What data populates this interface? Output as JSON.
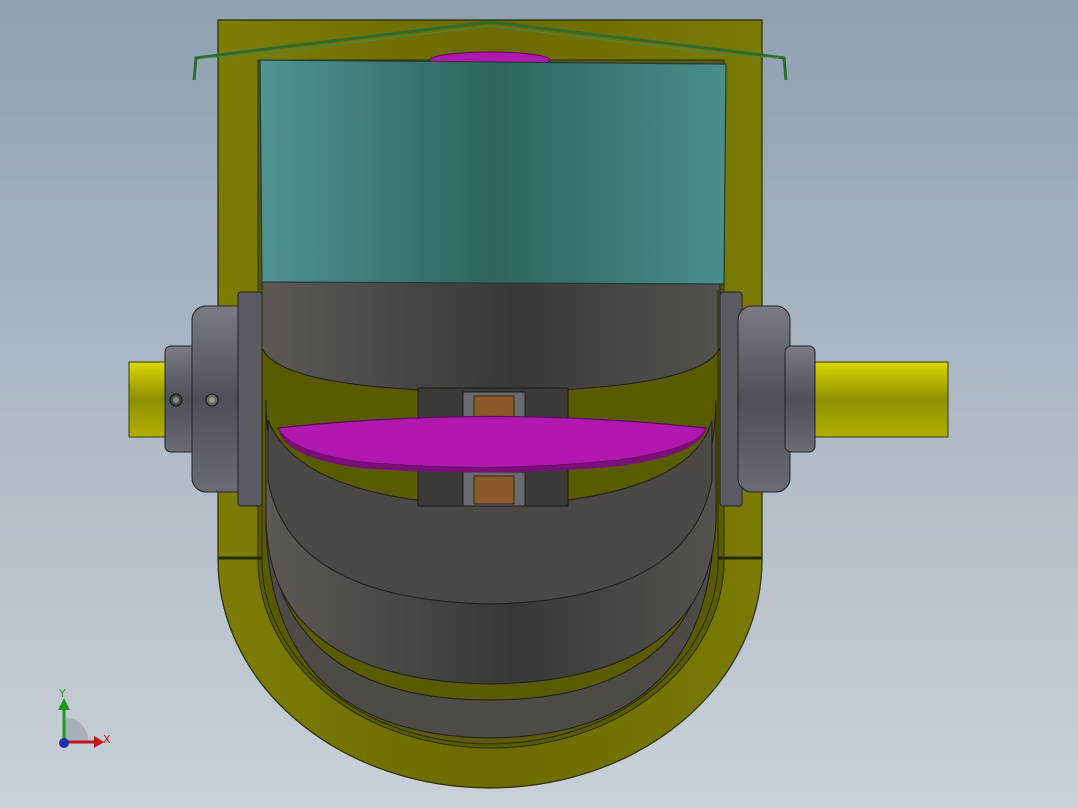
{
  "viewport": {
    "background_top": "#8fa0b1",
    "background_bottom": "#c9d0d8"
  },
  "model": {
    "part_colors": {
      "housing": "#6e6e00",
      "housing_light": "#9a9a12",
      "cover_wire": "#2e6b2e",
      "upper_body": "#3f7f7c",
      "inner_bowl": "#4a4845",
      "disc": "#b018b0",
      "hub_copper": "#8a5a2a",
      "bearing_flange": "#5d5e66",
      "shaft": "#b8b800"
    }
  },
  "triad": {
    "x_label": "X",
    "y_label": "Y",
    "x_color": "#c41818",
    "y_color": "#1a9a1a",
    "z_color": "#1a2fa8"
  }
}
